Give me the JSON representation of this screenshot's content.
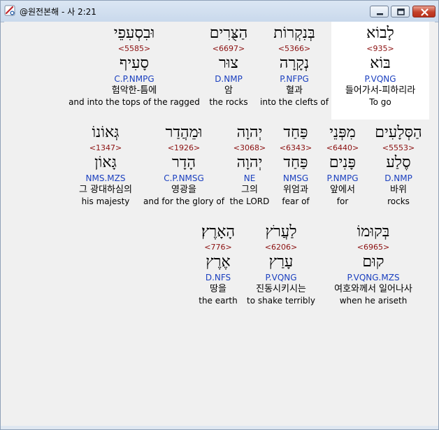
{
  "window": {
    "title": "@원전본해 - 사 2:21",
    "colors": {
      "strong": "#8b1010",
      "morph": "#1a3fbf",
      "selected_bg": "#ffffff"
    }
  },
  "verse": {
    "ref": "사 2:21",
    "words": [
      {
        "surface": "לָבוֹא",
        "strong": "<935>",
        "lemma": "בּוֹא",
        "morph": "P.VQNG",
        "korean": "들어가서-피하리라",
        "english": "To go",
        "selected": true
      },
      {
        "surface": "בְּנִקְרוֹת",
        "strong": "<5366>",
        "lemma": "נְקָרָה",
        "morph": "P.NFPG",
        "korean": "혈과",
        "english": "into the clefts of"
      },
      {
        "surface": "הַצֻּרִים",
        "strong": "<6697>",
        "lemma": "צוּר",
        "morph": "D.NMP",
        "korean": "암",
        "english": "the rocks"
      },
      {
        "surface": "וּבִסְעִפֵי",
        "strong": "<5585>",
        "lemma": "סָעִיף",
        "morph": "C.P.NMPG",
        "korean": "험악한-틈에",
        "english": "and into the tops of the ragged"
      },
      {
        "surface": "הַסְּלָעִים",
        "strong": "<5553>",
        "lemma": "סֶלַע",
        "morph": "D.NMP",
        "korean": "바위",
        "english": "rocks"
      },
      {
        "surface": "מִפְּנֵי",
        "strong": "<6440>",
        "lemma": "פָּנִים",
        "morph": "P.NMPG",
        "korean": "앞에서",
        "english": "for"
      },
      {
        "surface": "פַּחַד",
        "strong": "<6343>",
        "lemma": "פַּחַד",
        "morph": "NMSG",
        "korean": "위엄과",
        "english": "fear of"
      },
      {
        "surface": "יְהוָה",
        "strong": "<3068>",
        "lemma": "יְהוָה",
        "morph": "NE",
        "korean": "그의",
        "english": "the LORD"
      },
      {
        "surface": "וּמֵהֲדַר",
        "strong": "<1926>",
        "lemma": "הָדָר",
        "morph": "C.P.NMSG",
        "korean": "영광을",
        "english": "and for the glory of"
      },
      {
        "surface": "גְּאוֹנוֹ",
        "strong": "<1347>",
        "lemma": "גָּאוֹן",
        "morph": "NMS.MZS",
        "korean": "그 광대하심의",
        "english": "his majesty"
      },
      {
        "surface": "בְּקוּמוֹ",
        "strong": "<6965>",
        "lemma": "קוּם",
        "morph": "P.VQNG.MZS",
        "korean": "여호와께서 일어나사",
        "english": "when he ariseth"
      },
      {
        "surface": "לַעֲרֹץ",
        "strong": "<6206>",
        "lemma": "עָרַץ",
        "morph": "P.VQNG",
        "korean": "진동시키시는",
        "english": "to shake terribly"
      },
      {
        "surface": "הָאָרֶץ׃",
        "strong": "<776>",
        "lemma": "אֶרֶץ",
        "morph": "D.NFS",
        "korean": "땅을",
        "english": "the earth"
      }
    ]
  }
}
